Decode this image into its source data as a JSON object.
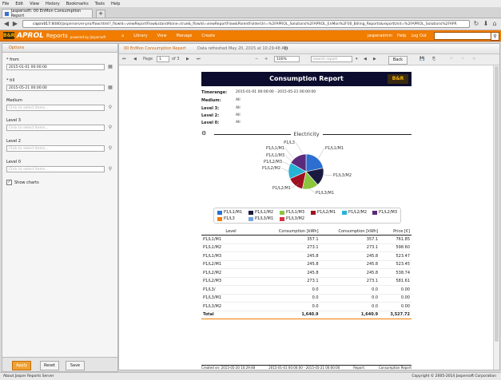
{
  "browser": {
    "menu": [
      "File",
      "Edit",
      "View",
      "History",
      "Bookmarks",
      "Tools",
      "Help"
    ],
    "tab_title": "Jaspersoft: 00 EnMon Consumption Report",
    "url_host": "ciqsrv017",
    "url_rest": ":8080/jasperserver-pro/flow.html?_flowId=viewReportFlow&standAlone=true&_flowId=viewReportFlow&ParentFolderUri=%2FAPROL_Solutions%2FAPROL_EnMon%2F00_Billing_Reports&reportUnit=%2FAPROL_Solutions%2FAPR"
  },
  "app": {
    "brand": "APROL",
    "brand_suffix": "Reports",
    "powered_by": "powered by Jaspersoft",
    "logo_glyph": "B&R",
    "nav": [
      "Home",
      "Library",
      "View",
      "Manage",
      "Create"
    ],
    "user": "jasperadmin",
    "help": "Help",
    "logout": "Log Out"
  },
  "options": {
    "title": "Options",
    "from_label": "* from",
    "from_value": "2015-01-01 00:00:00",
    "till_label": "* till",
    "till_value": "2015-05-21 00:00:00",
    "medium_label": "Medium",
    "level3_label": "Level 3",
    "level2_label": "Level 2",
    "level0_label": "Level 0",
    "placeholder": "Click to select items...",
    "show_charts": "Show charts",
    "apply": "Apply",
    "reset": "Reset",
    "save": "Save"
  },
  "viewer": {
    "title": "00 EnMon Consumption Report",
    "refreshed": "Data refreshed May 20, 2015 at 10:29:48 AM",
    "page_label": "Page",
    "page": "1",
    "of": "of 3",
    "zoom": "100%",
    "search_placeholder": "search report",
    "back": "Back"
  },
  "report": {
    "title": "Consumption Report",
    "meta": [
      {
        "k": "Timerange:",
        "v": "2015-01-01 00:00:00     -  2015-05-21 00:00:00"
      },
      {
        "k": "Medium:",
        "v": "All"
      },
      {
        "k": "Level 3:",
        "v": "All"
      },
      {
        "k": "Level 2:",
        "v": "All"
      },
      {
        "k": "Level 0:",
        "v": "All"
      }
    ],
    "section": "Electricity",
    "legend": [
      {
        "name": "P1/L1/M1",
        "color": "#2d6fd0"
      },
      {
        "name": "P1/L1/M2",
        "color": "#1a1a40"
      },
      {
        "name": "P1/L1/M3",
        "color": "#8cc63f"
      },
      {
        "name": "P1/L2/M1",
        "color": "#a01020"
      },
      {
        "name": "P1/L2/M2",
        "color": "#27b3d6"
      },
      {
        "name": "P1/L2/M3",
        "color": "#5b2a7a"
      },
      {
        "name": "P1/L3",
        "color": "#f07c00"
      },
      {
        "name": "P1/L3/M1",
        "color": "#74a4e0"
      },
      {
        "name": "P1/L3/M2",
        "color": "#d83040"
      }
    ],
    "pie_labels": {
      "a": "P1/L1/M1",
      "b": "P1/L2/M2",
      "c": "P1/L1/M3",
      "d": "P1/L2/M1",
      "e": "P1/L2/M3",
      "f": "P1/L3/M2",
      "g": "P1/L3/M1",
      "h": "P1/L3",
      "i": "P1/L1/M1"
    },
    "table_headers": [
      "Level",
      "Consumption [kWh]",
      "Consumption [kWh]",
      "Price [€]"
    ],
    "rows": [
      {
        "level": "P1/L1/M1",
        "c1": "357.1",
        "c2": "357.1",
        "price": "761.85"
      },
      {
        "level": "P1/L1/M2",
        "c1": "273.1",
        "c2": "273.1",
        "price": "598.60"
      },
      {
        "level": "P1/L1/M3",
        "c1": "245.8",
        "c2": "245.8",
        "price": "523.47"
      },
      {
        "level": "P1/L2/M1",
        "c1": "245.8",
        "c2": "245.8",
        "price": "523.45"
      },
      {
        "level": "P1/L2/M2",
        "c1": "245.8",
        "c2": "245.8",
        "price": "538.74"
      },
      {
        "level": "P1/L2/M3",
        "c1": "273.1",
        "c2": "273.1",
        "price": "581.61"
      },
      {
        "level": "P1/L3/",
        "c1": "0.0",
        "c2": "0.0",
        "price": "0.00"
      },
      {
        "level": "P1/L3/M1",
        "c1": "0.0",
        "c2": "0.0",
        "price": "0.00"
      },
      {
        "level": "P1/L3/M2",
        "c1": "0.0",
        "c2": "0.0",
        "price": "0.00"
      }
    ],
    "total": {
      "level": "Total",
      "c1": "1,640.9",
      "c2": "1,640.9",
      "price": "3,527.72"
    },
    "footer": {
      "created": "Created on:   2015-05-20 10:29:48",
      "range": "2015-01-01 00:00:00  -  2015-05-21 00:00:00",
      "report_label": "Report:",
      "report_name": "Consumption Report"
    }
  },
  "status": {
    "left": "About Jasper Reports Server",
    "right": "Copyright © 2005-2014 Jaspersoft Corporation"
  },
  "chart_data": {
    "type": "pie",
    "title": "Electricity",
    "categories": [
      "P1/L1/M1",
      "P1/L1/M2",
      "P1/L1/M3",
      "P1/L2/M1",
      "P1/L2/M2",
      "P1/L2/M3",
      "P1/L3",
      "P1/L3/M1",
      "P1/L3/M2"
    ],
    "values": [
      357.1,
      273.1,
      245.8,
      245.8,
      245.8,
      273.1,
      0.0,
      0.0,
      0.0
    ],
    "colors": [
      "#2d6fd0",
      "#1a1a40",
      "#8cc63f",
      "#a01020",
      "#27b3d6",
      "#5b2a7a",
      "#f07c00",
      "#74a4e0",
      "#d83040"
    ]
  }
}
